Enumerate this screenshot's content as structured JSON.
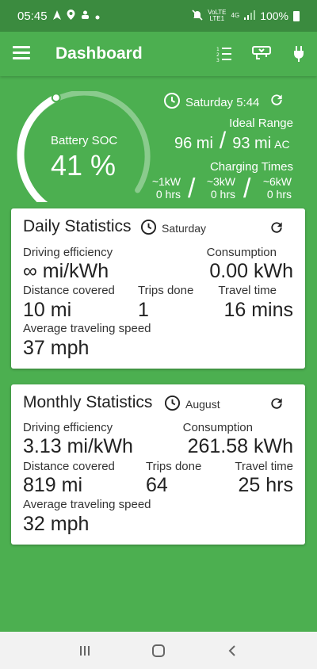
{
  "status_bar": {
    "time": "05:45",
    "network_top": "VoLTE",
    "network_bottom": "LTE1",
    "network_type": "4G",
    "battery": "100%",
    "icons": [
      "navigation-icon",
      "location-icon",
      "recycle-icon",
      "dot-icon",
      "mute-icon",
      "signal-icon",
      "battery-icon"
    ]
  },
  "app_bar": {
    "title": "Dashboard",
    "icons": [
      "menu-icon",
      "list-icon",
      "charger-icon",
      "plug-icon"
    ]
  },
  "summary": {
    "battery_label": "Battery SOC",
    "battery_value": "41 %",
    "battery_fraction": 0.41,
    "time_label": "Saturday 5:44",
    "ideal_range_label": "Ideal Range",
    "range_1": "96 mi",
    "range_sep": "/",
    "range_2": "93 mi",
    "range_2_suffix": "AC",
    "charging_label": "Charging Times",
    "charging": [
      {
        "power": "~1kW",
        "time": "0 hrs"
      },
      {
        "power": "~3kW",
        "time": "0 hrs"
      },
      {
        "power": "~6kW",
        "time": "0 hrs"
      }
    ]
  },
  "daily": {
    "title": "Daily Statistics",
    "period": "Saturday",
    "efficiency_label": "Driving efficiency",
    "efficiency_value": "∞ mi/kWh",
    "consumption_label": "Consumption",
    "consumption_value": "0.00 kWh",
    "distance_label": "Distance covered",
    "distance_value": "10 mi",
    "trips_label": "Trips done",
    "trips_value": "1",
    "travel_label": "Travel time",
    "travel_value": "16 mins",
    "speed_label": "Average traveling speed",
    "speed_value": "37 mph"
  },
  "monthly": {
    "title": "Monthly Statistics",
    "period": "August",
    "efficiency_label": "Driving efficiency",
    "efficiency_value": "3.13 mi/kWh",
    "consumption_label": "Consumption",
    "consumption_value": "261.58 kWh",
    "distance_label": "Distance covered",
    "distance_value": "819 mi",
    "trips_label": "Trips done",
    "trips_value": "64",
    "travel_label": "Travel time",
    "travel_value": "25 hrs",
    "speed_label": "Average traveling speed",
    "speed_value": "32 mph"
  },
  "colors": {
    "accent": "#4caf50",
    "status_bar": "#3b8b3f",
    "card": "#ffffff",
    "nav_bar": "#f2f2f2"
  },
  "nav_bar": {
    "icons": [
      "recents-icon",
      "home-icon",
      "back-icon"
    ]
  }
}
